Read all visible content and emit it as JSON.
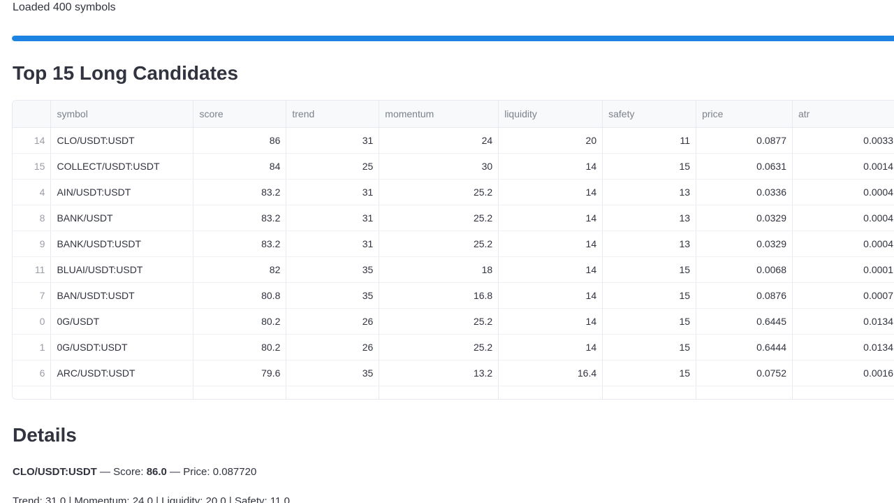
{
  "status": {
    "loaded_text": "Loaded 400 symbols"
  },
  "progress": {
    "value_percent": 100,
    "color": "#1c83e1"
  },
  "top_section": {
    "title": "Top 15 Long Candidates"
  },
  "table": {
    "columns": [
      "",
      "symbol",
      "score",
      "trend",
      "momentum",
      "liquidity",
      "safety",
      "price",
      "atr"
    ],
    "rows": [
      {
        "idx": "14",
        "symbol": "CLO/USDT:USDT",
        "score": "86",
        "trend": "31",
        "momentum": "24",
        "liquidity": "20",
        "safety": "11",
        "price": "0.0877",
        "atr": "0.0033"
      },
      {
        "idx": "15",
        "symbol": "COLLECT/USDT:USDT",
        "score": "84",
        "trend": "25",
        "momentum": "30",
        "liquidity": "14",
        "safety": "15",
        "price": "0.0631",
        "atr": "0.0014"
      },
      {
        "idx": "4",
        "symbol": "AIN/USDT:USDT",
        "score": "83.2",
        "trend": "31",
        "momentum": "25.2",
        "liquidity": "14",
        "safety": "13",
        "price": "0.0336",
        "atr": "0.0004"
      },
      {
        "idx": "8",
        "symbol": "BANK/USDT",
        "score": "83.2",
        "trend": "31",
        "momentum": "25.2",
        "liquidity": "14",
        "safety": "13",
        "price": "0.0329",
        "atr": "0.0004"
      },
      {
        "idx": "9",
        "symbol": "BANK/USDT:USDT",
        "score": "83.2",
        "trend": "31",
        "momentum": "25.2",
        "liquidity": "14",
        "safety": "13",
        "price": "0.0329",
        "atr": "0.0004"
      },
      {
        "idx": "11",
        "symbol": "BLUAI/USDT:USDT",
        "score": "82",
        "trend": "35",
        "momentum": "18",
        "liquidity": "14",
        "safety": "15",
        "price": "0.0068",
        "atr": "0.0001"
      },
      {
        "idx": "7",
        "symbol": "BAN/USDT:USDT",
        "score": "80.8",
        "trend": "35",
        "momentum": "16.8",
        "liquidity": "14",
        "safety": "15",
        "price": "0.0876",
        "atr": "0.0007"
      },
      {
        "idx": "0",
        "symbol": "0G/USDT",
        "score": "80.2",
        "trend": "26",
        "momentum": "25.2",
        "liquidity": "14",
        "safety": "15",
        "price": "0.6445",
        "atr": "0.0134"
      },
      {
        "idx": "1",
        "symbol": "0G/USDT:USDT",
        "score": "80.2",
        "trend": "26",
        "momentum": "25.2",
        "liquidity": "14",
        "safety": "15",
        "price": "0.6444",
        "atr": "0.0134"
      },
      {
        "idx": "6",
        "symbol": "ARC/USDT:USDT",
        "score": "79.6",
        "trend": "35",
        "momentum": "13.2",
        "liquidity": "16.4",
        "safety": "15",
        "price": "0.0752",
        "atr": "0.0016"
      }
    ]
  },
  "details": {
    "title": "Details",
    "symbol": "CLO/USDT:USDT",
    "sep1": " — Score: ",
    "score": "86.0",
    "sep2": " — Price: 0.087720",
    "breakdown": "Trend: 31.0 | Momentum: 24.0 | Liquidity: 20.0 | Safety: 11.0"
  }
}
